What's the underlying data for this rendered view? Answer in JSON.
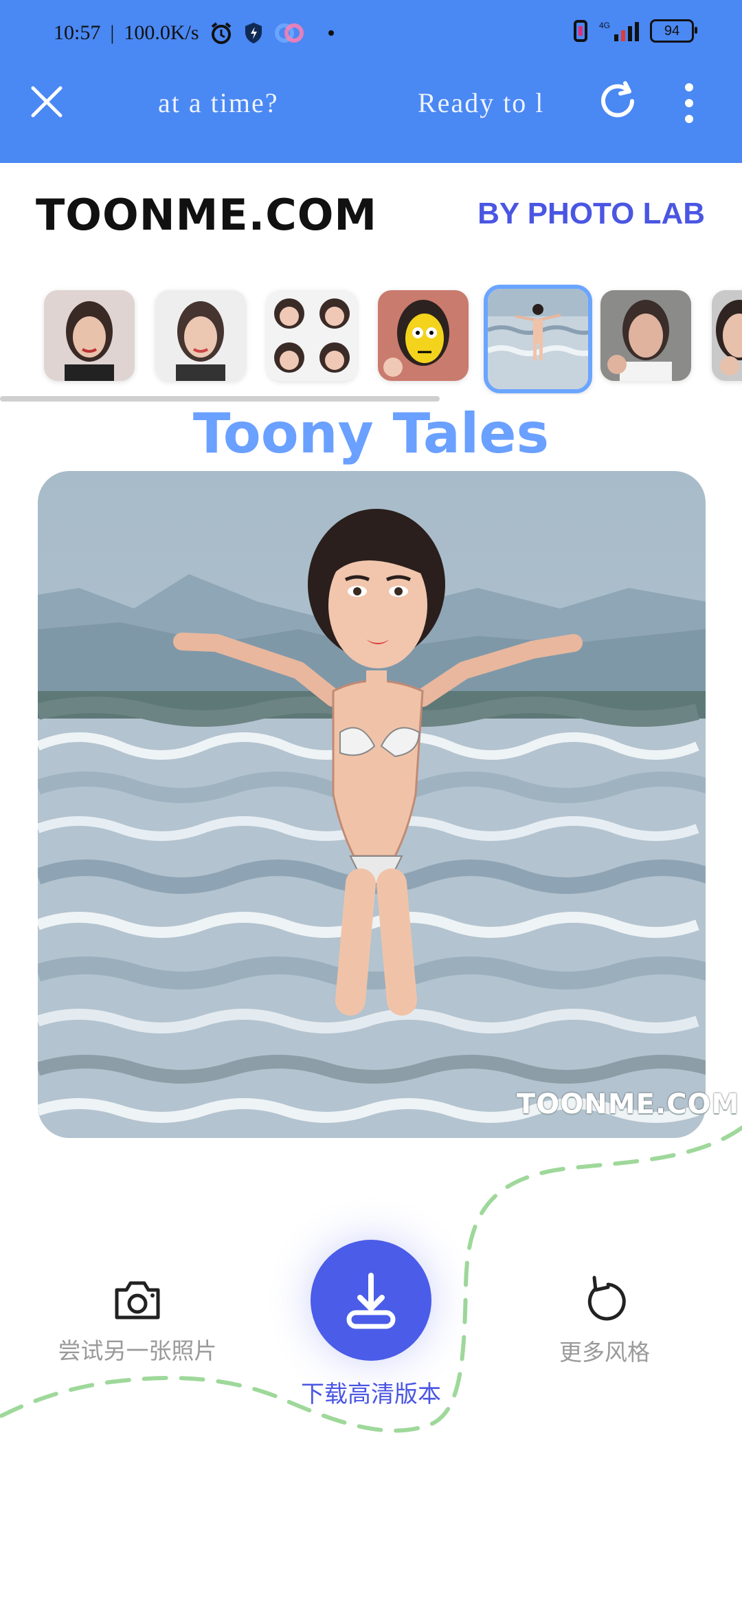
{
  "status_bar": {
    "time": "10:57",
    "separator": "|",
    "net_speed": "100.0K/s",
    "battery": "94",
    "network_type": "4G"
  },
  "appbar": {
    "marquee_left": "at a time?",
    "marquee_right": "Ready to l"
  },
  "brand": {
    "logo_text": "TOONME.COM",
    "by_text": "BY PHOTO LAB"
  },
  "style_thumbnails": [
    {
      "name": "style-1",
      "selected": false
    },
    {
      "name": "style-2",
      "selected": false
    },
    {
      "name": "style-3",
      "selected": false
    },
    {
      "name": "style-4",
      "selected": false
    },
    {
      "name": "style-5",
      "selected": true
    },
    {
      "name": "style-6",
      "selected": false
    },
    {
      "name": "style-7",
      "selected": false
    }
  ],
  "main": {
    "title": "Toony Tales",
    "watermark": "TOONME.COM"
  },
  "actions": {
    "try_another": "尝试另一张照片",
    "download": "下载高清版本",
    "more_styles": "更多风格"
  },
  "colors": {
    "appbar": "#4a88f3",
    "accent": "#4a5ce8",
    "title": "#6aa0ff",
    "selected_border": "#6aa5ff",
    "dashed_path": "#9ed89a"
  }
}
